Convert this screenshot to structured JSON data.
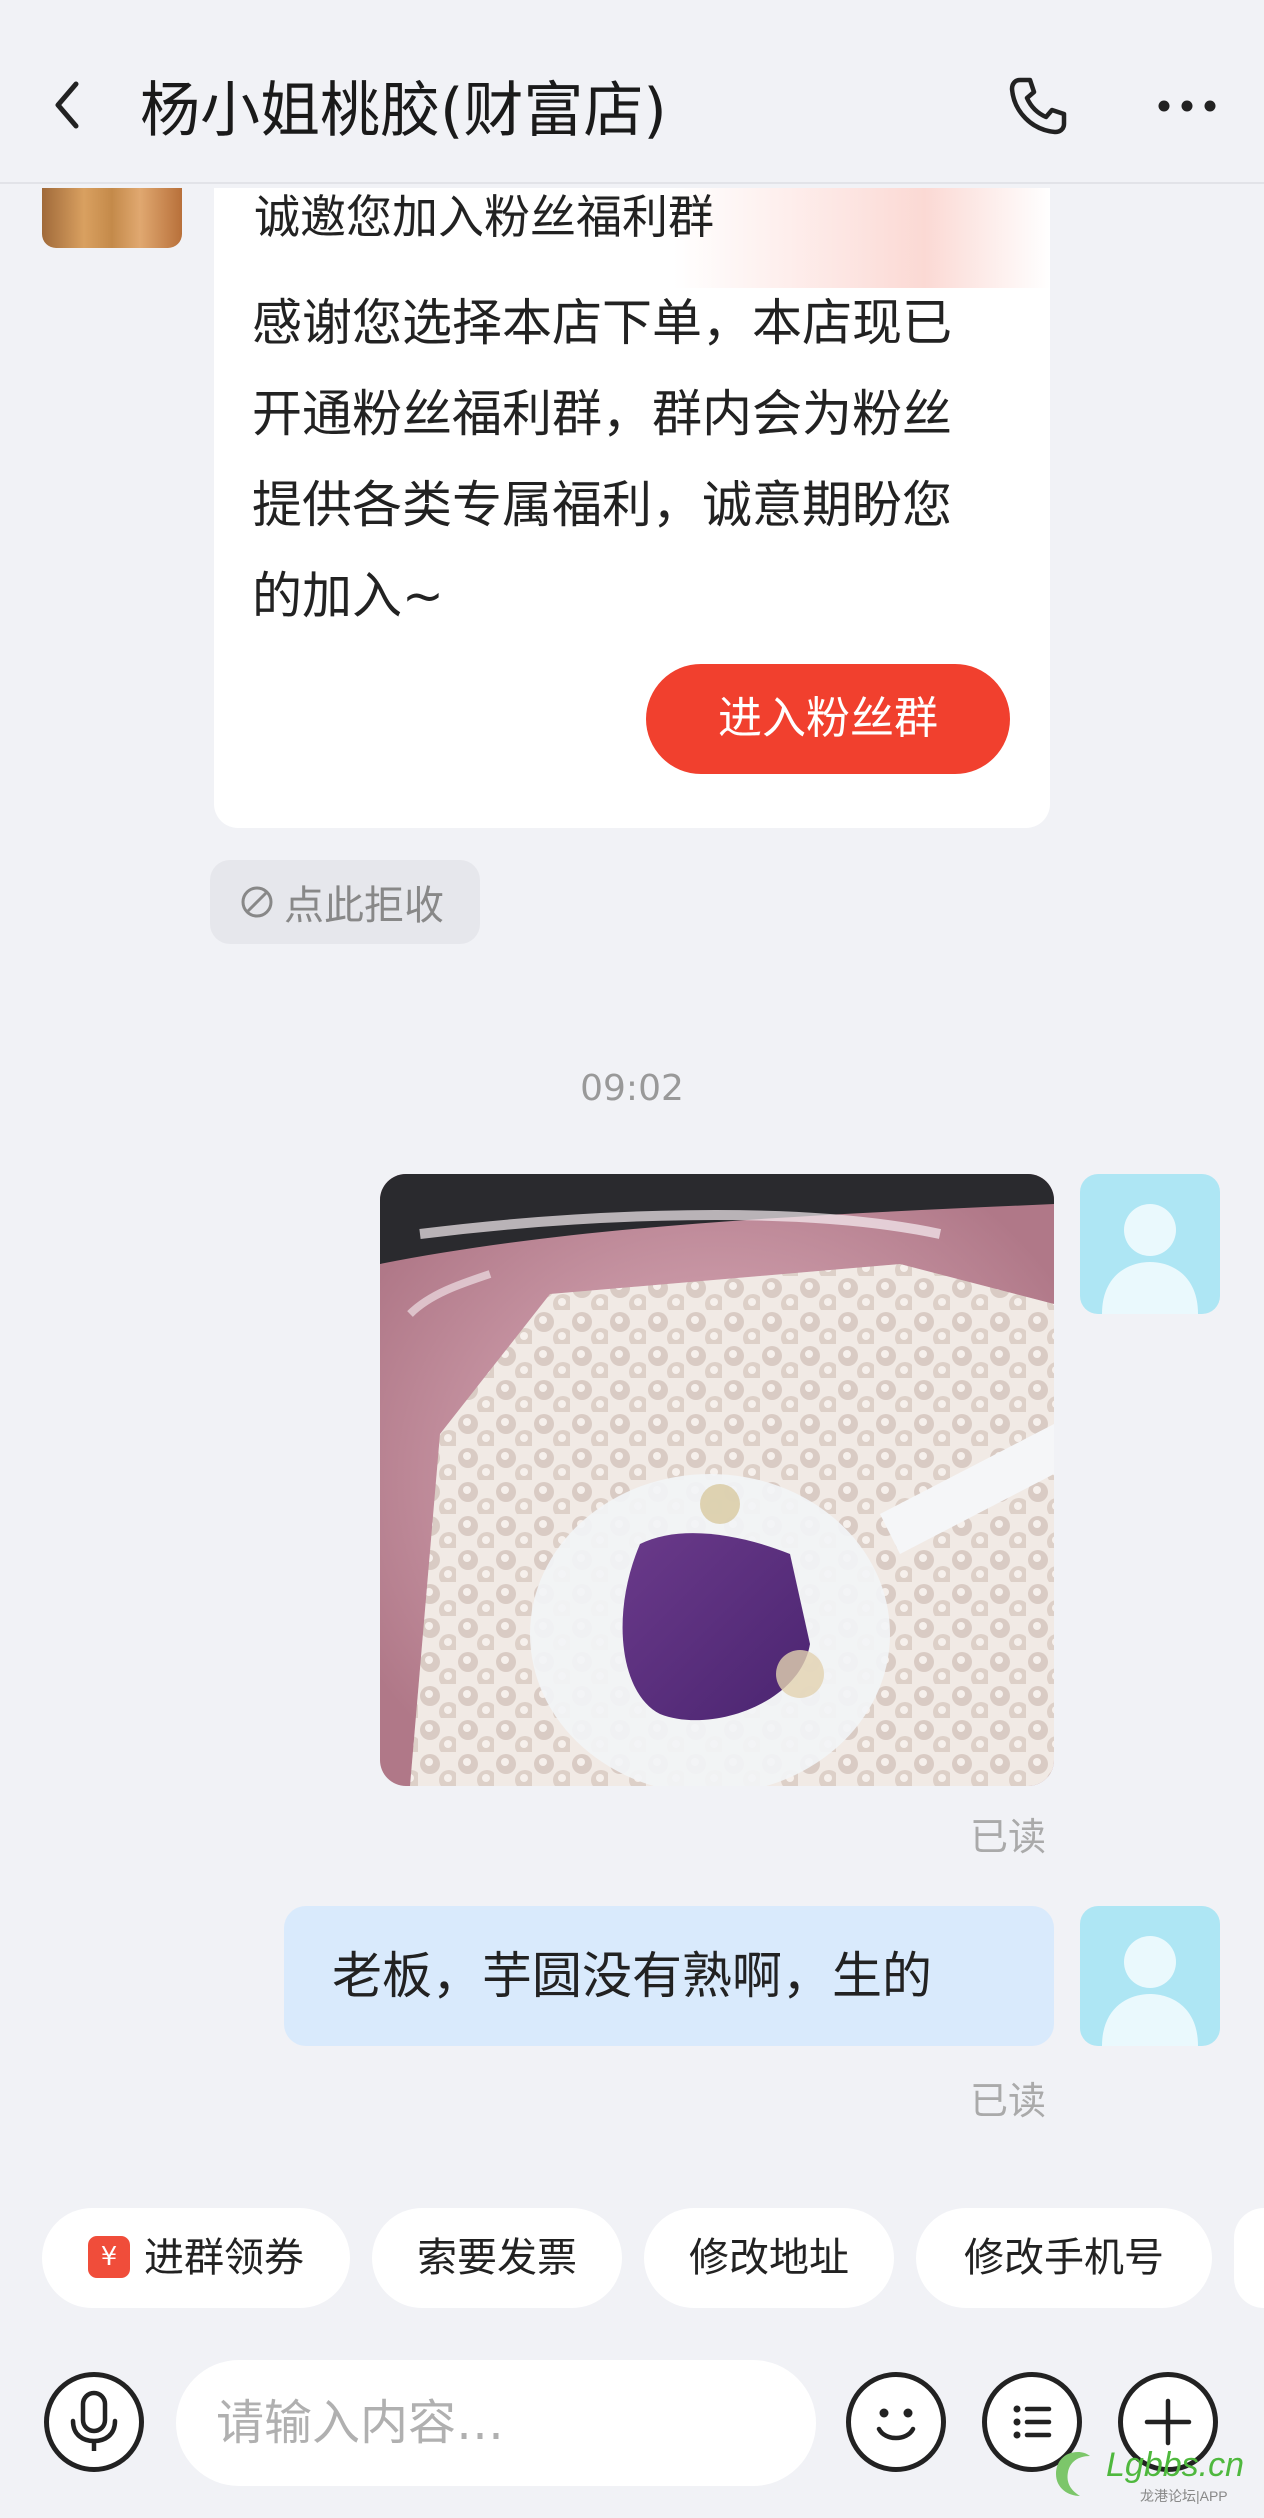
{
  "header": {
    "title": "杨小姐桃胶(财富店)",
    "back_icon": "chevron-left-icon",
    "phone_icon": "phone-icon",
    "more_icon": "more-horizontal-icon"
  },
  "invite_card": {
    "title": "诚邀您加入粉丝福利群",
    "body": "感谢您选择本店下单，本店现已开通粉丝福利群，群内会为粉丝提供各类专属福利，诚意期盼您的加入~",
    "button_label": "进入粉丝群",
    "button_color": "#f1402e"
  },
  "decline": {
    "label": "点此拒收",
    "icon": "ban-icon"
  },
  "messages": {
    "timestamp": "09:02",
    "image_read_status": "已读",
    "text_message": "老板，芋圆没有熟啊，生的",
    "text_read_status": "已读",
    "bubble_color": "#d9eafc"
  },
  "quick_replies": [
    {
      "label": "进群领券",
      "icon": "coupon-icon",
      "icon_glyph": "¥"
    },
    {
      "label": "索要发票"
    },
    {
      "label": "修改地址"
    },
    {
      "label": "修改手机号"
    }
  ],
  "input_bar": {
    "placeholder": "请输入内容…",
    "voice_icon": "microphone-icon",
    "emoji_icon": "emoji-icon",
    "menu_icon": "list-menu-icon",
    "plus_icon": "plus-icon"
  },
  "watermark": {
    "text": "Lgbbs.cn",
    "sub": "龙港论坛|APP"
  }
}
